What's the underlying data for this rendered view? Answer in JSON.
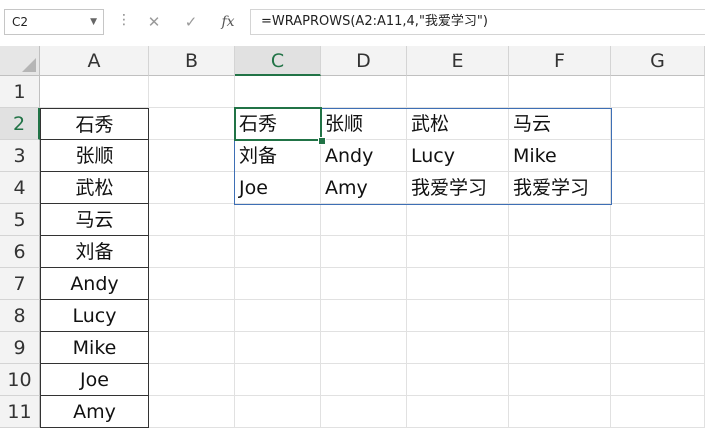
{
  "name_box": "C2",
  "formula_bar": {
    "cancel_icon": "✕",
    "enter_icon": "✓",
    "fx_label": "fx",
    "formula": "=WRAPROWS(A2:A11,4,\"我爱学习\")"
  },
  "columns": [
    "A",
    "B",
    "C",
    "D",
    "E",
    "F",
    "G"
  ],
  "rows": [
    "1",
    "2",
    "3",
    "4",
    "5",
    "6",
    "7",
    "8",
    "9",
    "10",
    "11"
  ],
  "source_column_A": [
    "石秀",
    "张顺",
    "武松",
    "马云",
    "刘备",
    "Andy",
    "Lucy",
    "Mike",
    "Joe",
    "Amy"
  ],
  "spill_result": [
    [
      "石秀",
      "张顺",
      "武松",
      "马云"
    ],
    [
      "刘备",
      "Andy",
      "Lucy",
      "Mike"
    ],
    [
      "Joe",
      "Amy",
      "我爱学习",
      "我爱学习"
    ]
  ],
  "colors": {
    "accent": "#217346",
    "spill_border": "#3e6fb5"
  }
}
